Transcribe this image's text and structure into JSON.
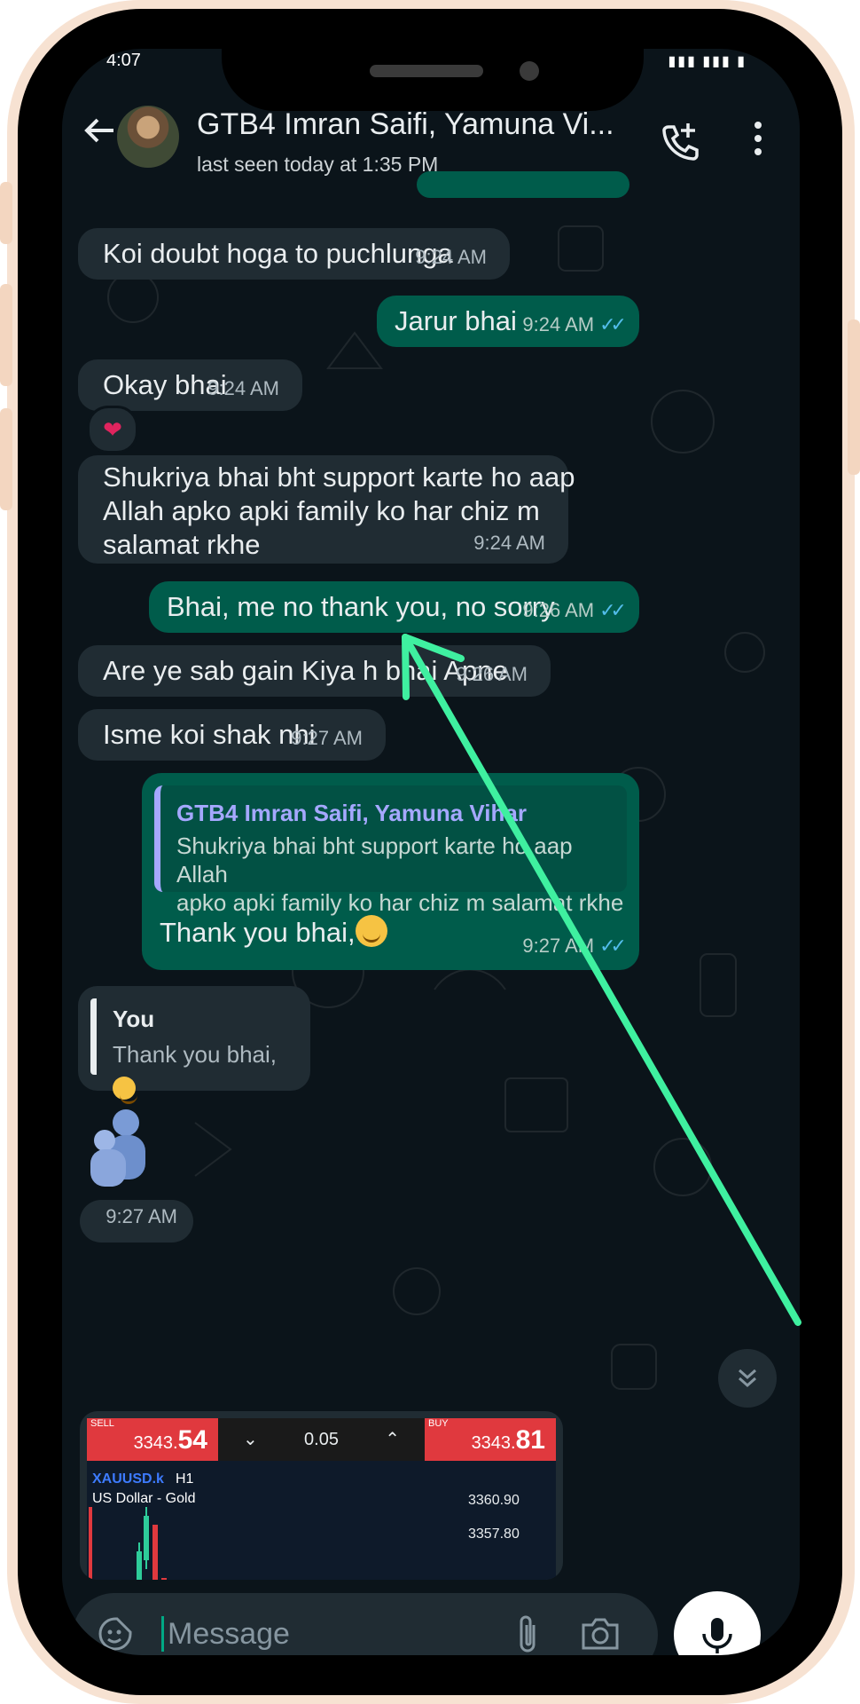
{
  "status": {
    "time": "4:07"
  },
  "header": {
    "name": "GTB4 Imran Saifi, Yamuna Vi...",
    "last_seen": "last seen today at 1:35 PM"
  },
  "messages": [
    {
      "dir": "in",
      "text": "Koi doubt hoga to puchlunga",
      "time": "9:24 AM"
    },
    {
      "dir": "out",
      "text": "Jarur bhai",
      "time": "9:24 AM"
    },
    {
      "dir": "in",
      "text": "Okay bhai",
      "time": "9:24 AM",
      "reaction": "heart"
    },
    {
      "dir": "in",
      "lines": [
        "Shukriya bhai bht support karte ho aap",
        "Allah apko apki family ko har chiz m",
        "salamat rkhe"
      ],
      "time": "9:24 AM"
    },
    {
      "dir": "out",
      "text": "Bhai, me no thank you, no sorry",
      "time": "9:26 AM"
    },
    {
      "dir": "in",
      "text": "Are ye sab gain Kiya h bhai Apne",
      "time": "9:26 AM"
    },
    {
      "dir": "in",
      "text": "Isme koi shak nhi",
      "time": "9:27 AM"
    },
    {
      "dir": "out",
      "quote_name": "GTB4 Imran Saifi, Yamuna Vihar",
      "quote_lines": [
        "Shukriya bhai bht support karte ho aap Allah",
        "apko apki family ko har chiz m salamat rkhe"
      ],
      "text": "Thank you bhai,",
      "time": "9:27 AM"
    },
    {
      "dir": "in",
      "quote_name": "You",
      "quote_text": "Thank you bhai,",
      "sticker": "hug",
      "time": "9:27 AM"
    }
  ],
  "trade": {
    "sell_label": "SELL",
    "sell_price_small": "3343.",
    "sell_price_big": "54",
    "lot": "0.05",
    "buy_label": "BUY",
    "buy_price_small": "3343.",
    "buy_price_big": "81",
    "symbol": "XAUUSD.k",
    "timeframe": "H1",
    "description": "US Dollar - Gold",
    "axis": [
      "3360.90",
      "3357.80"
    ]
  },
  "input": {
    "placeholder": "Message"
  },
  "colors": {
    "background": "#0b141a",
    "incoming": "#202c33",
    "outgoing": "#005c4b",
    "read_ticks": "#53bdeb",
    "annotation_arrow": "#3ff0a0"
  },
  "icons": [
    "back-arrow-icon",
    "add-call-icon",
    "menu-icon",
    "heart-icon",
    "scroll-down-icon",
    "sticker-icon",
    "attach-icon",
    "camera-icon",
    "mic-icon"
  ]
}
